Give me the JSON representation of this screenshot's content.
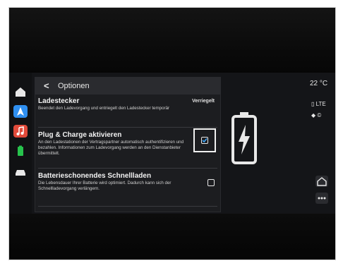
{
  "header": {
    "back_label": "<",
    "title": "Optionen"
  },
  "rows": [
    {
      "title": "Ladestecker",
      "description": "Beendet den Ladevorgang und entriegelt den Ladestecker temporär",
      "status": "Verriegelt"
    },
    {
      "title": "Plug & Charge aktivieren",
      "description": "An den Ladestationen der Vertragspartner automatisch authentifizieren und bezahlen. Informationen zum Ladevorgang werden an den Dienstanbieter übermittelt.",
      "checked": true
    },
    {
      "title": "Batterieschonendes Schnellladen",
      "description": "Die Lebensdauer Ihrer Batterie wird optimiert. Dadurch kann sich der Schnellladevorgang verlängern.",
      "checked": false
    }
  ],
  "status_bar": {
    "temperature": "22 °C",
    "network": "LTE"
  },
  "colors": {
    "accent_checkbox": "#3da9ff",
    "nav_blue": "#2f8ff0",
    "music_red": "#e04a3a",
    "battery_green": "#27c24c"
  },
  "icons": [
    "home-icon",
    "navigation-icon",
    "music-icon",
    "battery-icon",
    "car-icon",
    "lightning-icon",
    "more-icon"
  ]
}
